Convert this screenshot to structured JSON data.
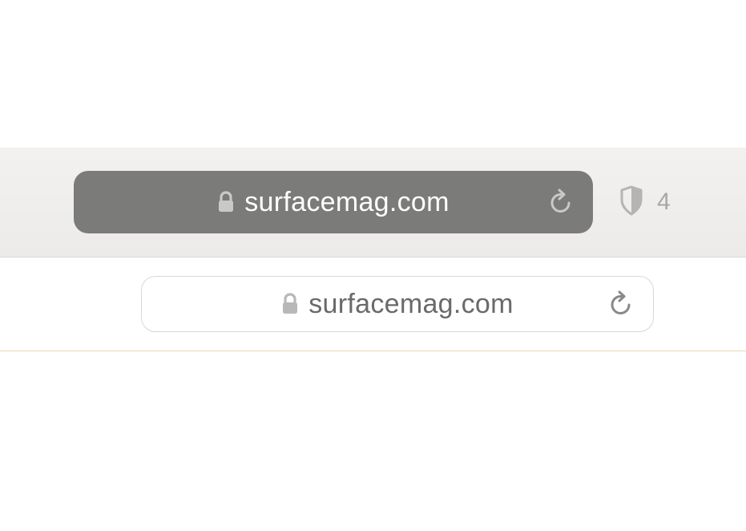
{
  "toolbars": {
    "dark": {
      "url": "surfacemag.com",
      "shield_count": "4"
    },
    "light": {
      "url": "surfacemag.com"
    }
  }
}
